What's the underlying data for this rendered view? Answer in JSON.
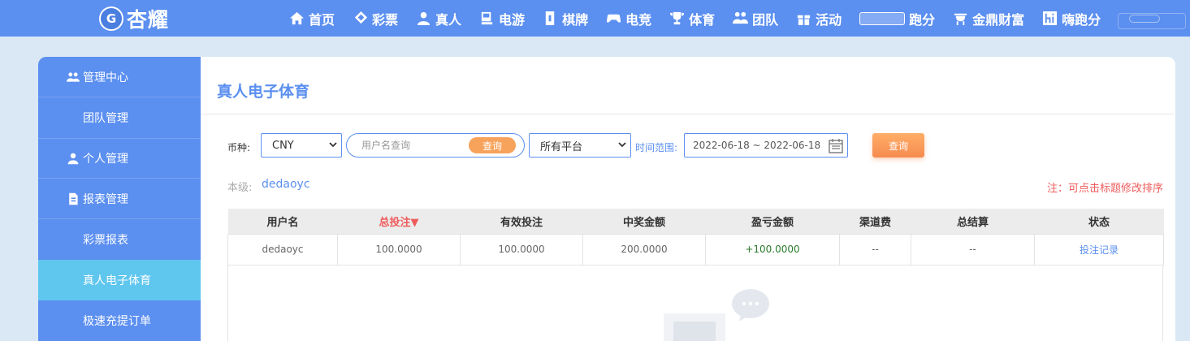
{
  "brand": {
    "name": "杏耀",
    "mark": "G"
  },
  "nav": [
    {
      "label": "首页",
      "icon": "home-icon"
    },
    {
      "label": "彩票",
      "icon": "ticket-icon"
    },
    {
      "label": "真人",
      "icon": "dealer-icon"
    },
    {
      "label": "电游",
      "icon": "arcade-icon"
    },
    {
      "label": "棋牌",
      "icon": "cards-icon"
    },
    {
      "label": "电竞",
      "icon": "gamepad-icon"
    },
    {
      "label": "体育",
      "icon": "trophy-icon"
    },
    {
      "label": "团队",
      "icon": "team-icon"
    },
    {
      "label": "活动",
      "icon": "gift-icon"
    },
    {
      "label": "跑分",
      "icon": "car-icon"
    },
    {
      "label": "金鼎财富",
      "icon": "cauldron-icon"
    },
    {
      "label": "嗨跑分",
      "icon": "hi-icon"
    }
  ],
  "sidebar": {
    "items": [
      {
        "label": "管理中心",
        "icon": "users-icon",
        "type": "section"
      },
      {
        "label": "团队管理",
        "type": "sub"
      },
      {
        "label": "个人管理",
        "icon": "user-icon",
        "type": "section"
      },
      {
        "label": "报表管理",
        "icon": "report-icon",
        "type": "section"
      },
      {
        "label": "彩票报表",
        "type": "sub"
      },
      {
        "label": "真人电子体育",
        "type": "sub",
        "active": true
      },
      {
        "label": "极速充提订单",
        "type": "sub"
      }
    ]
  },
  "main": {
    "title": "真人电子体育",
    "filters": {
      "currency_label": "币种:",
      "currency_value": "CNY",
      "search_placeholder": "用户名查询",
      "search_button": "查询",
      "platform_value": "所有平台",
      "range_label": "时间范围:",
      "date_range": "2022-06-18 ~ 2022-06-18",
      "query_button": "查询"
    },
    "level_label": "本级:",
    "level_value": "dedaoyc",
    "note": "注：可点击标题修改排序",
    "table": {
      "headers": [
        "用户名",
        "总投注▼",
        "有效投注",
        "中奖金额",
        "盈亏金额",
        "渠道费",
        "总结算",
        "状态"
      ],
      "rows": [
        [
          "dedaoyc",
          "100.0000",
          "100.0000",
          "200.0000",
          "+100.0000",
          "--",
          "--",
          "投注记录"
        ]
      ]
    }
  },
  "colors": {
    "primary": "#5b8ff0",
    "active": "#5fc6ee",
    "accent": "#f7a35c",
    "alert": "#ef5b5b",
    "positive": "#2a7a2a"
  }
}
